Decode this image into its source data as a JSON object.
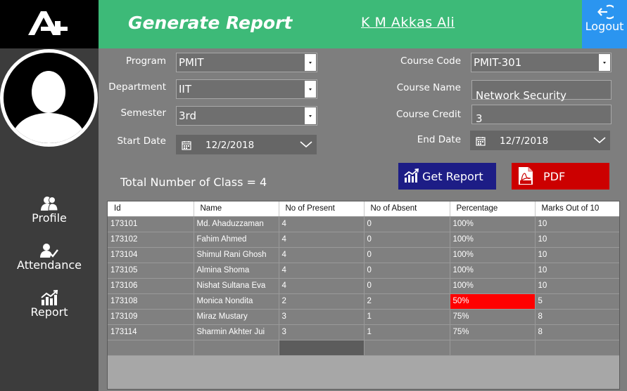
{
  "header": {
    "title": "Generate Report",
    "user_name": "K M Akkas Ali",
    "logout_label": "Logout"
  },
  "sidebar": {
    "items": [
      {
        "label": "Profile",
        "icon": "users-icon"
      },
      {
        "label": "Attendance",
        "icon": "user-check-icon"
      },
      {
        "label": "Report",
        "icon": "chart-icon"
      }
    ]
  },
  "form": {
    "program": {
      "label": "Program",
      "value": "PMIT"
    },
    "department": {
      "label": "Department",
      "value": "IIT"
    },
    "semester": {
      "label": "Semester",
      "value": "3rd"
    },
    "start_date": {
      "label": "Start Date",
      "value": "12/2/2018"
    },
    "course_code": {
      "label": "Course Code",
      "value": "PMIT-301"
    },
    "course_name": {
      "label": "Course Name",
      "value": "Network Security"
    },
    "course_credit": {
      "label": "Course Credit",
      "value": "3"
    },
    "end_date": {
      "label": "End Date",
      "value": "12/7/2018"
    }
  },
  "summary": {
    "total_classes": "Total Number of Class = 4"
  },
  "buttons": {
    "get_report": "Get Report",
    "pdf": "PDF"
  },
  "colors": {
    "header": "#3dba78",
    "logout": "#2b95f0",
    "report_button": "#1d1d86",
    "pdf_button": "#cc0000",
    "low_percentage": "#ff0000"
  },
  "table": {
    "columns": [
      "Id",
      "Name",
      "No of Present",
      "No of Absent",
      "Percentage",
      "Marks Out of 10"
    ],
    "rows": [
      [
        "173101",
        "Md. Ahaduzzaman",
        "4",
        "0",
        "100%",
        "10"
      ],
      [
        "173102",
        "Fahim Ahmed",
        "4",
        "0",
        "100%",
        "10"
      ],
      [
        "173104",
        "Shimul Rani Ghosh",
        "4",
        "0",
        "100%",
        "10"
      ],
      [
        "173105",
        "Almina Shoma",
        "4",
        "0",
        "100%",
        "10"
      ],
      [
        "173106",
        "Nishat Sultana Eva",
        "4",
        "0",
        "100%",
        "10"
      ],
      [
        "173108",
        "Monica Nondita",
        "2",
        "2",
        "50%",
        "5"
      ],
      [
        "173109",
        "Miraz Mustary",
        "3",
        "1",
        "75%",
        "8"
      ],
      [
        "173114",
        "Sharmin Akhter Jui",
        "3",
        "1",
        "75%",
        "8"
      ]
    ],
    "highlighted_percentage": "50%"
  }
}
